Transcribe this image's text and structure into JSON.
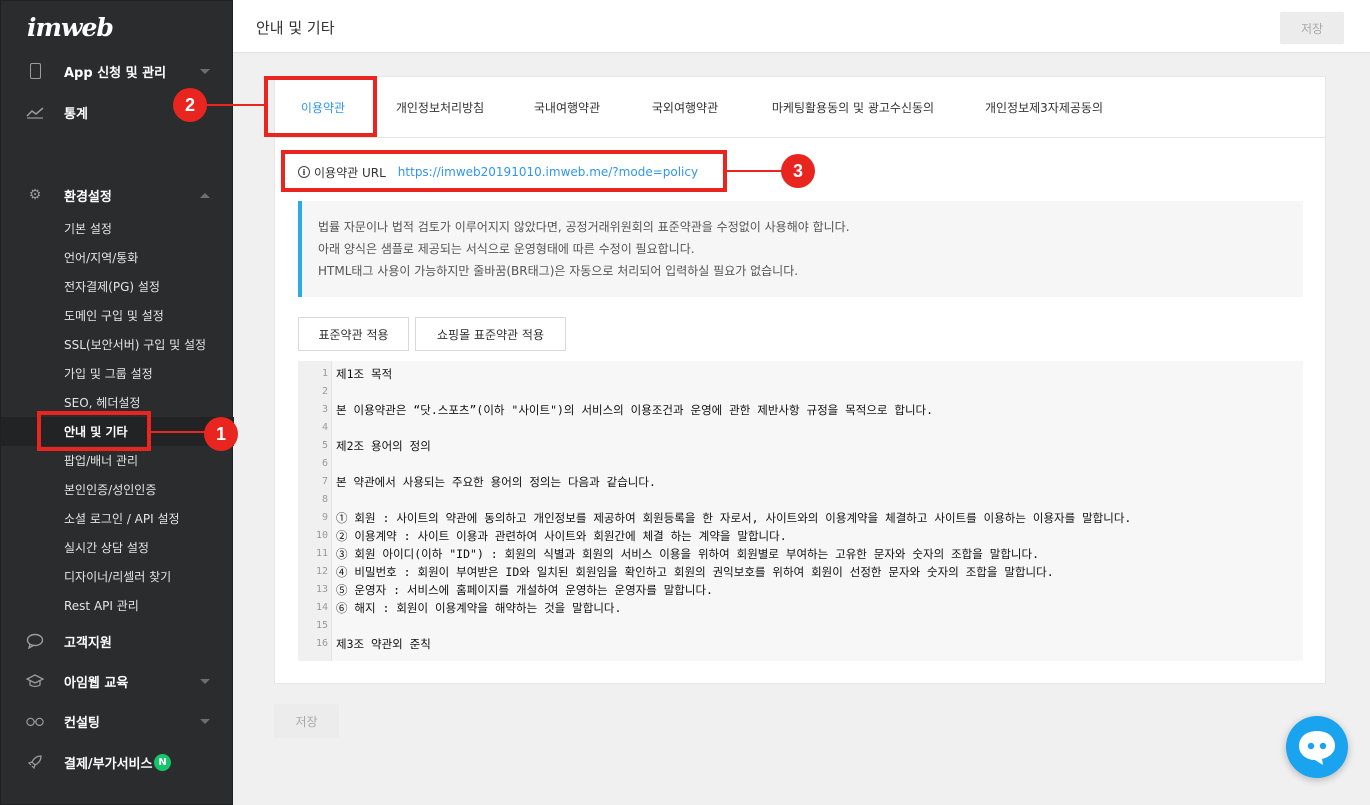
{
  "brand": {
    "logo_text": "imweb"
  },
  "sidebar": {
    "top_items": [
      {
        "label": "App 신청 및 관리",
        "icon": "mobile-phone-icon"
      },
      {
        "label": "통계",
        "icon": "chart-line-icon"
      }
    ],
    "settings": {
      "label": "환경설정",
      "icon": "gear-icon",
      "items": [
        {
          "label": "기본 설정"
        },
        {
          "label": "언어/지역/통화"
        },
        {
          "label": "전자결제(PG) 설정"
        },
        {
          "label": "도메인 구입 및 설정"
        },
        {
          "label": "SSL(보안서버) 구입 및 설정"
        },
        {
          "label": "가입 및 그룹 설정"
        },
        {
          "label": "SEO, 헤더설정"
        },
        {
          "label": "안내 및 기타"
        },
        {
          "label": "팝업/배너 관리"
        },
        {
          "label": "본인인증/성인인증"
        },
        {
          "label": "소셜 로그인 / API 설정"
        },
        {
          "label": "실시간 상담 설정"
        },
        {
          "label": "디자이너/리셀러 찾기"
        },
        {
          "label": "Rest API 관리"
        }
      ]
    },
    "bottom_items": [
      {
        "label": "고객지원",
        "icon": "chat-bubble-icon"
      },
      {
        "label": "아임웹 교육",
        "icon": "graduation-cap-icon"
      },
      {
        "label": "컨설팅",
        "icon": "glasses-icon"
      },
      {
        "label": "결제/부가서비스",
        "icon": "rocket-icon",
        "badge": "N"
      }
    ]
  },
  "header": {
    "title": "안내 및 기타",
    "save_label": "저장"
  },
  "tabs": [
    {
      "label": "이용약관"
    },
    {
      "label": "개인정보처리방침"
    },
    {
      "label": "국내여행약관"
    },
    {
      "label": "국외여행약관"
    },
    {
      "label": "마케팅활용동의 및 광고수신동의"
    },
    {
      "label": "개인정보제3자제공동의"
    }
  ],
  "policy_url": {
    "label": "이용약관 URL",
    "url": "https://imweb20191010.imweb.me/?mode=policy"
  },
  "notice": [
    "법률 자문이나 법적 검토가 이루어지지 않았다면, 공정거래위원회의 표준약관을 수정없이 사용해야 합니다.",
    "아래 양식은 샘플로 제공되는 서식으로 운영형태에 따른 수정이 필요합니다.",
    "HTML태그 사용이 가능하지만 줄바꿈(BR태그)은 자동으로 처리되어 입력하실 필요가 없습니다."
  ],
  "template_buttons": {
    "standard": "표준약관 적용",
    "shopping": "쇼핑몰 표준약관 적용"
  },
  "editor": {
    "lines": [
      {
        "num": "1",
        "text": "제1조 목적"
      },
      {
        "num": "2",
        "text": ""
      },
      {
        "num": "3",
        "text": "본 이용약관은 “닷.스포츠”(이하 \"사이트\")의 서비스의 이용조건과 운영에 관한 제반사항 규정을 목적으로 합니다."
      },
      {
        "num": "4",
        "text": ""
      },
      {
        "num": "5",
        "text": "제2조 용어의 정의"
      },
      {
        "num": "6",
        "text": ""
      },
      {
        "num": "7",
        "text": "본 약관에서 사용되는 주요한 용어의 정의는 다음과 같습니다."
      },
      {
        "num": "8",
        "text": ""
      },
      {
        "num": "9",
        "text": "① 회원 : 사이트의 약관에 동의하고 개인정보를 제공하여 회원등록을 한 자로서, 사이트와의 이용계약을 체결하고 사이트를 이용하는 이용자를 말합니다."
      },
      {
        "num": "10",
        "text": "② 이용계약 : 사이트 이용과 관련하여 사이트와 회원간에 체결 하는 계약을 말합니다."
      },
      {
        "num": "11",
        "text": "③ 회원 아이디(이하 \"ID\") : 회원의 식별과 회원의 서비스 이용을 위하여 회원별로 부여하는 고유한 문자와 숫자의 조합을 말합니다."
      },
      {
        "num": "12",
        "text": "④ 비밀번호 : 회원이 부여받은 ID와 일치된 회원임을 확인하고 회원의 권익보호를 위하여 회원이 선정한 문자와 숫자의 조합을 말합니다."
      },
      {
        "num": "13",
        "text": "⑤ 운영자 : 서비스에 홈페이지를 개설하여 운영하는 운영자를 말합니다."
      },
      {
        "num": "14",
        "text": "⑥ 해지 : 회원이 이용계약을 해약하는 것을 말합니다."
      },
      {
        "num": "15",
        "text": ""
      },
      {
        "num": "16",
        "text": "제3조 약관외 준칙"
      }
    ]
  },
  "footer": {
    "save_label": "저장"
  },
  "annotations": {
    "one": "1",
    "two": "2",
    "three": "3"
  },
  "colors": {
    "accent": "#3196ea",
    "annotation": "#e8251f",
    "sidebar_bg": "#2b2c2e",
    "notice_border": "#2ca9e6",
    "badge": "#15c46b"
  }
}
